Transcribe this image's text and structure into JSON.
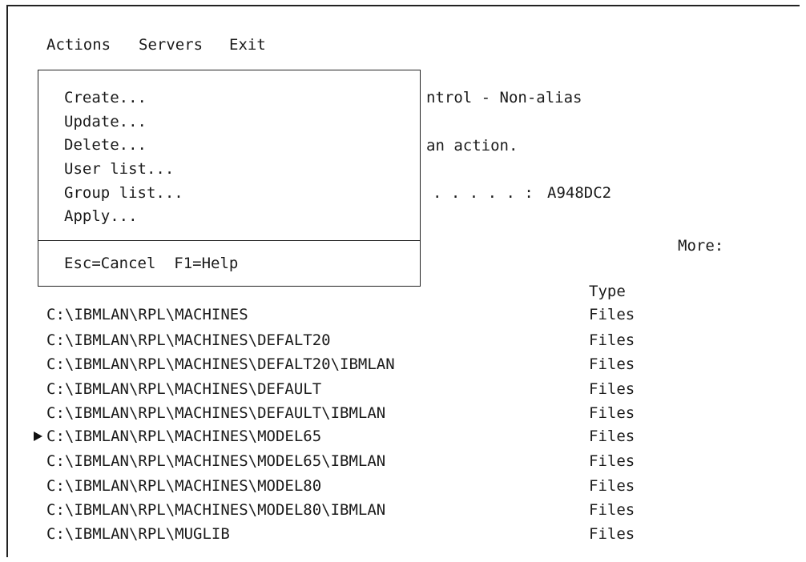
{
  "menu_bar": {
    "items": [
      "Actions",
      "Servers",
      "Exit"
    ]
  },
  "popup_menu": {
    "items": [
      "Create...",
      "Update...",
      "Delete...",
      "User list...",
      "Group list...",
      "Apply..."
    ],
    "footer": "Esc=Cancel  F1=Help"
  },
  "panel": {
    "title_fragment": "ntrol - Non-alias",
    "instruction_fragment": "an action.",
    "field_leader": ". . . . . :",
    "field_value": "A948DC2",
    "more_label": "More:",
    "type_header": "Type"
  },
  "directory_list": {
    "selected_index": 5,
    "rows": [
      {
        "path": "C:\\IBMLAN\\RPL\\MACHINES",
        "type": "Files"
      },
      {
        "path": "C:\\IBMLAN\\RPL\\MACHINES\\DEFALT20",
        "type": "Files"
      },
      {
        "path": "C:\\IBMLAN\\RPL\\MACHINES\\DEFALT20\\IBMLAN",
        "type": "Files"
      },
      {
        "path": "C:\\IBMLAN\\RPL\\MACHINES\\DEFAULT",
        "type": "Files"
      },
      {
        "path": "C:\\IBMLAN\\RPL\\MACHINES\\DEFAULT\\IBMLAN",
        "type": "Files"
      },
      {
        "path": "C:\\IBMLAN\\RPL\\MACHINES\\MODEL65",
        "type": "Files"
      },
      {
        "path": "C:\\IBMLAN\\RPL\\MACHINES\\MODEL65\\IBMLAN",
        "type": "Files"
      },
      {
        "path": "C:\\IBMLAN\\RPL\\MACHINES\\MODEL80",
        "type": "Files"
      },
      {
        "path": "C:\\IBMLAN\\RPL\\MACHINES\\MODEL80\\IBMLAN",
        "type": "Files"
      },
      {
        "path": "C:\\IBMLAN\\RPL\\MUGLIB",
        "type": "Files"
      }
    ]
  }
}
